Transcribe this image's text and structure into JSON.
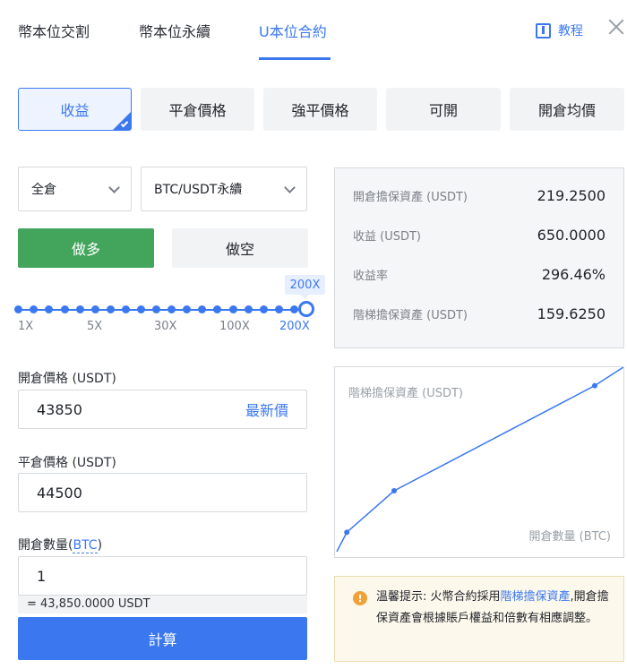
{
  "tabs": [
    {
      "label": "幣本位交割"
    },
    {
      "label": "幣本位永續"
    },
    {
      "label": "U本位合約",
      "active": true
    }
  ],
  "tutorial_label": "教程",
  "calc_types": [
    "收益",
    "平倉價格",
    "強平價格",
    "可開",
    "開倉均價"
  ],
  "form": {
    "margin_mode": "全倉",
    "contract": "BTC/USDT永續",
    "long_label": "做多",
    "short_label": "做空",
    "leverage": {
      "current": "200X",
      "selected_value": 200,
      "labels": [
        "1X",
        "5X",
        "30X",
        "100X",
        "200X"
      ]
    },
    "open_price": {
      "label": "開倉價格 (USDT)",
      "value": "43850",
      "action": "最新價"
    },
    "close_price": {
      "label": "平倉價格 (USDT)",
      "value": "44500"
    },
    "quantity": {
      "label_prefix": "開倉數量(",
      "unit": "BTC",
      "label_suffix": ")",
      "value": "1"
    },
    "conversion": "= 43,850.0000 USDT",
    "calculate_label": "計算"
  },
  "results": [
    {
      "label": "開倉擔保資產 (USDT)",
      "value": "219.2500"
    },
    {
      "label": "收益 (USDT)",
      "value": "650.0000"
    },
    {
      "label": "收益率",
      "value": "296.46%"
    },
    {
      "label": "階梯擔保資產 (USDT)",
      "value": "159.6250"
    }
  ],
  "chart_data": {
    "type": "line",
    "ylabel": "階梯擔保資產 (USDT)",
    "xlabel": "開倉數量 (BTC)",
    "series": [
      {
        "points": [
          [
            0.0,
            0.0
          ],
          [
            0.035,
            0.105
          ],
          [
            0.2,
            0.33
          ],
          [
            0.9,
            0.9
          ],
          [
            1.0,
            1.0
          ]
        ]
      }
    ],
    "note": "no tick values printed; values are relative"
  },
  "notice": {
    "prefix": "溫馨提示: 火幣合約採用",
    "link": "階梯擔保資產",
    "suffix": ",開倉擔保資產會根據賬戶權益和倍數有相應調整。"
  },
  "colors": {
    "accent": "#3b78f0",
    "long": "#42a55b",
    "warning": "#f0a13a"
  }
}
